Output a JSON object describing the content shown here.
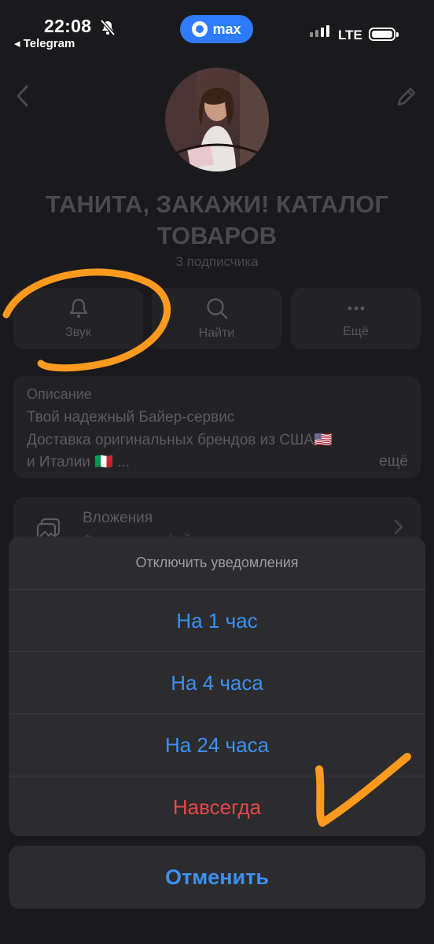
{
  "status_bar": {
    "time": "22:08",
    "back_app": "◂ Telegram",
    "badge_label": "max",
    "network": "LTE"
  },
  "header": {
    "back_icon": "chevron-left-icon",
    "edit_icon": "pencil-icon",
    "title_line1": "ТАНИТА, ЗАКАЖИ! КАТАЛОГ",
    "title_line2": "ТОВАРОВ",
    "subscribers": "3 подписчика"
  },
  "actions": [
    {
      "label": "Звук",
      "icon": "bell-icon"
    },
    {
      "label": "Найти",
      "icon": "search-icon"
    },
    {
      "label": "Ещё",
      "icon": "ellipsis-icon"
    }
  ],
  "description": {
    "heading": "Описание",
    "line1": "Твой надежный Байер-сервис",
    "line2": "Доставка оригинальных брендов из США🇺🇸",
    "line3": "и Италии 🇮🇹 ...",
    "more": "ещё"
  },
  "attachments": {
    "title": "Вложения",
    "subtitle": "Фото, видео, файлы и ссылки"
  },
  "sheet": {
    "title": "Отключить уведомления",
    "options": [
      {
        "label": "На 1 час"
      },
      {
        "label": "На 4 часа"
      },
      {
        "label": "На 24 часа"
      },
      {
        "label": "Навсегда"
      }
    ],
    "cancel": "Отменить"
  },
  "colors": {
    "accent": "#3d8ff2",
    "danger": "#e8464c",
    "annotation": "#ff9a1f",
    "badge": "#2f7bff"
  }
}
